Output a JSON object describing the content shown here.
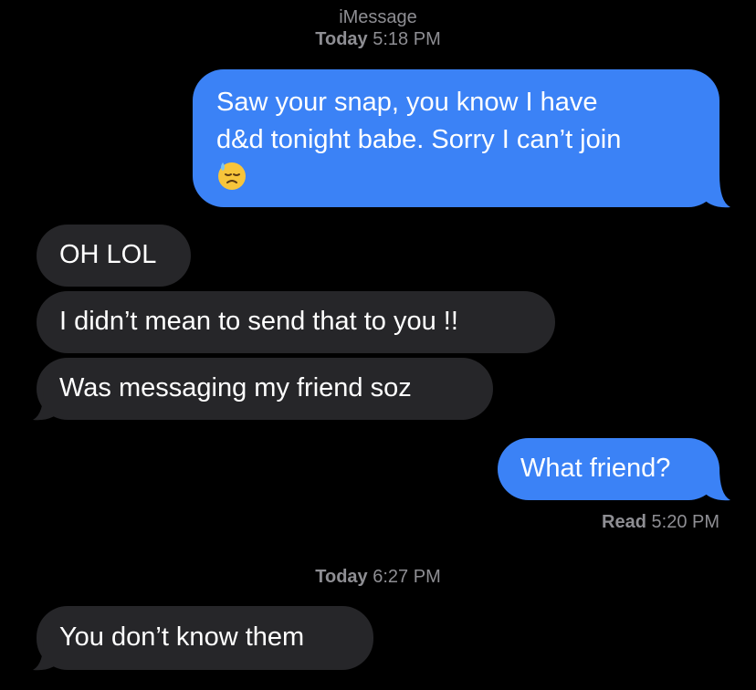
{
  "header": {
    "service": "iMessage",
    "day1": "Today",
    "time1": "5:18 PM"
  },
  "messages": [
    {
      "from": "me",
      "text_line1": "Saw your snap, you know I have",
      "text_line2": "d&d tonight babe. Sorry I can’t join",
      "emoji": "downcast-sweat-face"
    },
    {
      "from": "them",
      "text": "OH LOL"
    },
    {
      "from": "them",
      "text": "I didn’t mean to send that to you !!"
    },
    {
      "from": "them",
      "text": "Was messaging my friend soz"
    },
    {
      "from": "me",
      "text": "What friend?"
    },
    {
      "from": "them",
      "text": "You don’t know them"
    }
  ],
  "receipt": {
    "label": "Read",
    "time": "5:20 PM"
  },
  "separator2": {
    "day": "Today",
    "time": "6:27 PM"
  },
  "colors": {
    "background": "#000000",
    "sent_bubble": "#3b82f6",
    "received_bubble": "#262629",
    "meta_text": "#8e8e93"
  }
}
